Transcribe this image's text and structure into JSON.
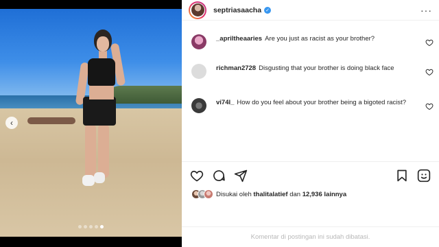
{
  "post": {
    "username": "septriasaacha",
    "verified": true,
    "slide_count": 5,
    "active_slide": 5
  },
  "comments": [
    {
      "user": "_apriltheaaries",
      "text": "Are you just as racist as your brother?",
      "avatar_color": "#a04a7c"
    },
    {
      "user": "richman2728",
      "text": "Disgusting that your brother is doing black face",
      "avatar_color": "#dcdcdc"
    },
    {
      "user": "vi74l_",
      "text": "How do you feel about your brother being a bigoted racist?",
      "avatar_color": "#555555"
    }
  ],
  "likes": {
    "prefix": "Disukai oleh",
    "user": "thalitalatief",
    "middle": "dan",
    "count": "12,936",
    "suffix": "lainnya"
  },
  "footer": {
    "notice": "Komentar di postingan ini sudah dibatasi."
  },
  "icons": [
    "more-icon",
    "heart-icon",
    "comment-icon",
    "share-icon",
    "bookmark-icon",
    "emoji-icon",
    "verified-icon",
    "chevron-left-icon"
  ],
  "colors": {
    "accent": "#3897f0",
    "muted": "#b8b8b8",
    "border": "#efefef"
  }
}
